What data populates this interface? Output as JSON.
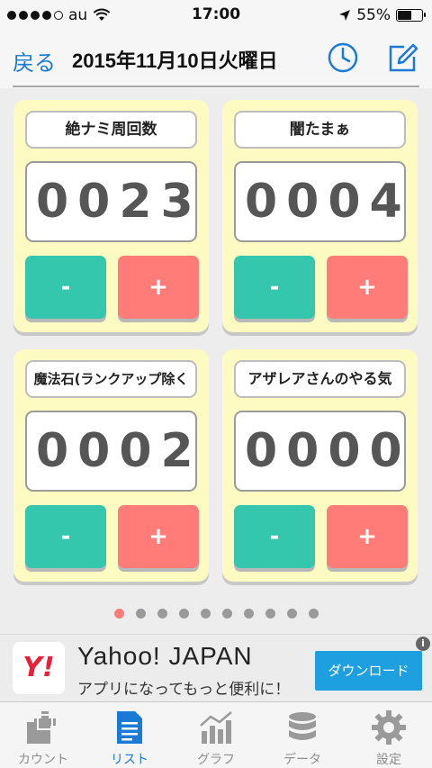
{
  "status_bar": {
    "carrier": "au",
    "time": "17:00",
    "battery": "55%"
  },
  "nav": {
    "back_label": "戻る",
    "title": "2015年11月10日火曜日",
    "history_icon": "clock-icon",
    "edit_icon": "compose-icon"
  },
  "counters": [
    {
      "label": "絶ナミ周回数",
      "value": "0023",
      "minus": "-",
      "plus": "+"
    },
    {
      "label": "闇たまぁ",
      "value": "0004",
      "minus": "-",
      "plus": "+"
    },
    {
      "label": "魔法石(ランクアップ除く",
      "value": "0002",
      "minus": "-",
      "plus": "+"
    },
    {
      "label": "アザレアさんのやる気",
      "value": "0000",
      "minus": "-",
      "plus": "+"
    }
  ],
  "pager": {
    "count": 10,
    "active_index": 0
  },
  "ad": {
    "logo": "Y!",
    "title": "Yahoo! JAPAN",
    "subtitle": "アプリになってもっと便利に！",
    "button": "ダウンロード",
    "info": "i"
  },
  "tabs": [
    {
      "label": "カウント",
      "icon": "counter-plus-icon"
    },
    {
      "label": "リスト",
      "icon": "list-document-icon"
    },
    {
      "label": "グラフ",
      "icon": "chart-icon"
    },
    {
      "label": "データ",
      "icon": "database-icon"
    },
    {
      "label": "設定",
      "icon": "gear-icon"
    }
  ],
  "colors": {
    "accent": "#1a7ad6",
    "card_bg": "#fdfbc2",
    "minus": "#35c7ae",
    "plus": "#ff7c78",
    "ad_button": "#1e9fe0"
  }
}
